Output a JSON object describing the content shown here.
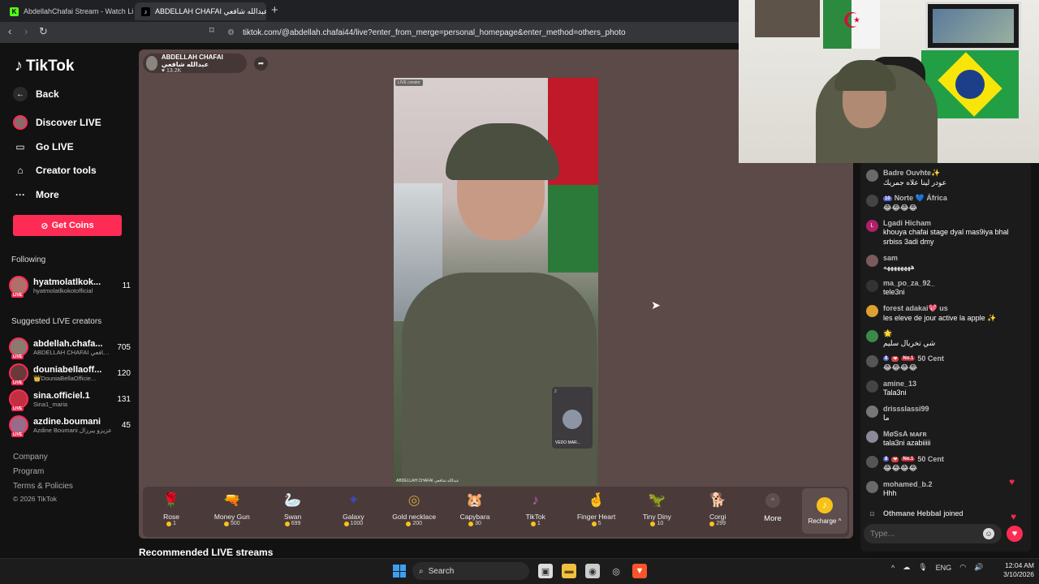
{
  "browser": {
    "tabs": [
      {
        "label": "AbdellahChafai Stream - Watch Live o"
      },
      {
        "label": "ABDELLAH CHAFAI عبدالله شافعي"
      }
    ],
    "url": "tiktok.com/@abdellah.chafai44/live?enter_from_merge=personal_homepage&enter_method=others_photo"
  },
  "sidebar": {
    "logo": "TikTok",
    "nav": [
      {
        "label": "Back",
        "icon": "back-arrow-icon"
      },
      {
        "label": "Discover LIVE",
        "icon": "discover-live-icon"
      },
      {
        "label": "Go LIVE",
        "icon": "camera-icon"
      },
      {
        "label": "Creator tools",
        "icon": "home-icon"
      },
      {
        "label": "More",
        "icon": "ellipsis-icon"
      }
    ],
    "coins_button": "Get Coins",
    "following_title": "Following",
    "following": [
      {
        "name": "hyatmolatlkok...",
        "sub": "hyatmolatlkokotofficial",
        "count": "11"
      }
    ],
    "suggested_title": "Suggested LIVE creators",
    "suggested": [
      {
        "name": "abdellah.chafa...",
        "sub": "ABDELLAH CHAFAI عبدالله شافعي",
        "count": "705"
      },
      {
        "name": "douniabellaoff...",
        "sub": "👑DouniaBellaOfficie...",
        "count": "120"
      },
      {
        "name": "sina.officiel.1",
        "sub": "Sina1_maria",
        "count": "131"
      },
      {
        "name": "azdine.boumani",
        "sub": "Azdine Boumani عزيزو يبرزال",
        "count": "45"
      }
    ],
    "footer": [
      "Company",
      "Program",
      "Terms & Policies",
      "© 2026 TikTok"
    ]
  },
  "host": {
    "name": "ABDELLAH CHAFAI عبدالله شافعي",
    "likes": "13.2K"
  },
  "video": {
    "badge": "LIVE creator",
    "caption": "ABDELLAH CHAFAI عبدالله شافعي",
    "guest_name": "VEDO MAR...",
    "guest_count": "2"
  },
  "gifts": [
    {
      "name": "Rose",
      "price": "1",
      "icon": "🌹",
      "color": "#c02040"
    },
    {
      "name": "Money Gun",
      "price": "500",
      "icon": "🔫",
      "color": "#b06ab0"
    },
    {
      "name": "Swan",
      "price": "699",
      "icon": "🦢",
      "color": "#7ab6d8"
    },
    {
      "name": "Galaxy",
      "price": "1000",
      "icon": "✦",
      "color": "#3a4ab0"
    },
    {
      "name": "Gold necklace",
      "price": "200",
      "icon": "◎",
      "color": "#c9a13a"
    },
    {
      "name": "Capybara",
      "price": "30",
      "icon": "🐹",
      "color": "#9a6a3a"
    },
    {
      "name": "TikTok",
      "price": "1",
      "icon": "♪",
      "color": "#c060c0"
    },
    {
      "name": "Finger Heart",
      "price": "5",
      "icon": "🤞",
      "color": "#e07060"
    },
    {
      "name": "Tiny Diny",
      "price": "10",
      "icon": "🦖",
      "color": "#4aa050"
    },
    {
      "name": "Corgi",
      "price": "299",
      "icon": "🐕",
      "color": "#e0a070"
    }
  ],
  "gift_more": "More",
  "recharge": "Recharge ^",
  "recommended_title": "Recommended LIVE streams",
  "chat": {
    "messages": [
      {
        "user": "Badre Ouvhte✨",
        "text": "عودر لينا علاه جمريك",
        "avatar_color": "#6a6a6a",
        "badges": []
      },
      {
        "user": "Norte 💙 África",
        "text": "😂😂😂😂",
        "avatar_color": "#444",
        "badges": [
          {
            "text": "10",
            "kind": "lvl"
          }
        ]
      },
      {
        "user": "Lgadi Hicham",
        "text": "khouya chafai stage dyal mas9iya bhal srbiss 3adi dmy",
        "avatar_color": "#b0206a",
        "avatar_letter": "L",
        "badges": []
      },
      {
        "user": "sam",
        "text": "ههههههههه",
        "avatar_color": "#7a5a5a",
        "badges": []
      },
      {
        "user": "ma_po_za_92_",
        "text": "tele3ni",
        "avatar_color": "#333",
        "badges": []
      },
      {
        "user": "forest adakai💖 us",
        "text": "les eleve de jour active la apple ✨",
        "avatar_color": "#e0a030",
        "badges": []
      },
      {
        "user": "🌟",
        "text": "شي تخريال سليم",
        "avatar_color": "#3a8a4a",
        "badges": []
      },
      {
        "user": "50 Cent",
        "text": "😂😂😂😂",
        "avatar_color": "#555",
        "badges": [
          {
            "text": "8",
            "kind": "lvl"
          },
          {
            "text": "❤",
            "kind": "fan"
          },
          {
            "text": "No.1",
            "kind": "no1"
          }
        ]
      },
      {
        "user": "amine_13",
        "text": "Tala3ni",
        "avatar_color": "#444",
        "badges": []
      },
      {
        "user": "drissslassi99",
        "text": "ما",
        "avatar_color": "#777",
        "badges": []
      },
      {
        "user": "MøSsA ᴍᴀғʀ",
        "text": "tala3ni azabiiiii",
        "avatar_color": "#8a8a9a",
        "badges": []
      },
      {
        "user": "50 Cent",
        "text": "😂😂😂😂",
        "avatar_color": "#555",
        "badges": [
          {
            "text": "8",
            "kind": "lvl"
          },
          {
            "text": "❤",
            "kind": "fan"
          },
          {
            "text": "No.1",
            "kind": "no1"
          }
        ]
      },
      {
        "user": "mohamed_b.2",
        "text": "Hhh",
        "avatar_color": "#6a6a6a",
        "badges": []
      }
    ],
    "join_user": "Othmane Hebbal",
    "join_text": "joined",
    "input_placeholder": "Type..."
  },
  "taskbar": {
    "search": "Search",
    "lang": "ENG",
    "time": "12:04 AM",
    "date": "3/10/2026"
  }
}
